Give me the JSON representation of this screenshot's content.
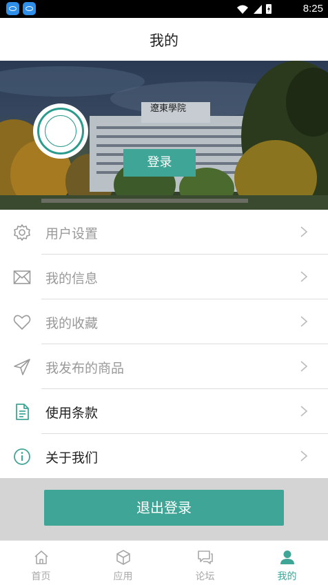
{
  "status_bar": {
    "time": "8:25"
  },
  "header": {
    "title": "我的"
  },
  "hero": {
    "login_label": "登录",
    "sign_text": "遼東學院"
  },
  "menu": {
    "items": [
      {
        "label": "用户设置",
        "icon": "gear-icon",
        "color": "#9a9a9a"
      },
      {
        "label": "我的信息",
        "icon": "mail-icon",
        "color": "#9a9a9a"
      },
      {
        "label": "我的收藏",
        "icon": "heart-icon",
        "color": "#9a9a9a"
      },
      {
        "label": "我发布的商品",
        "icon": "send-icon",
        "color": "#9a9a9a"
      },
      {
        "label": "使用条款",
        "icon": "document-icon",
        "color": "#222222"
      },
      {
        "label": "关于我们",
        "icon": "info-icon",
        "color": "#222222"
      }
    ]
  },
  "logout": {
    "label": "退出登录"
  },
  "tabs": [
    {
      "label": "首页",
      "icon": "home-icon",
      "active": false
    },
    {
      "label": "应用",
      "icon": "cube-icon",
      "active": false
    },
    {
      "label": "论坛",
      "icon": "chat-icon",
      "active": false
    },
    {
      "label": "我的",
      "icon": "person-icon",
      "active": true
    }
  ],
  "colors": {
    "accent": "#3fa596",
    "inactive": "#a8a8a8",
    "divider": "#dddddd"
  }
}
